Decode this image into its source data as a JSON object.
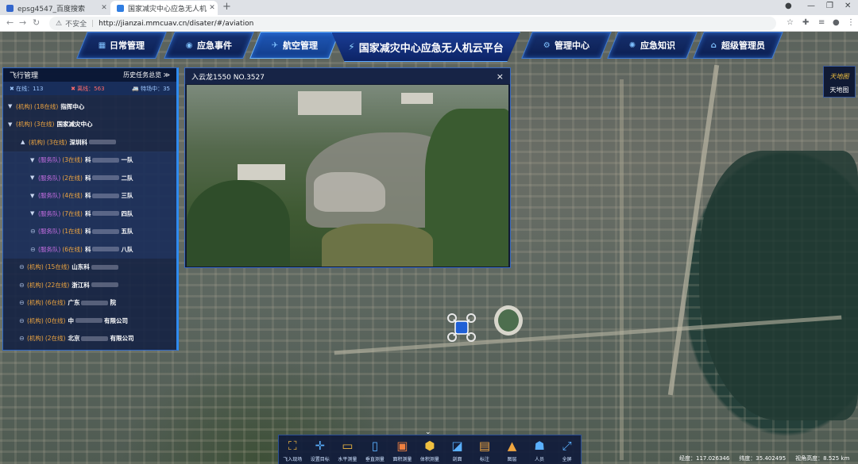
{
  "browser": {
    "tabs": [
      {
        "title": "epsg4547_百度搜索",
        "active": false
      },
      {
        "title": "国家减灾中心应急无人机云平",
        "active": true
      }
    ],
    "url_insecure": "不安全",
    "url": "http://jianzai.mmcuav.cn/disater/#/aviation"
  },
  "nav": {
    "items": [
      {
        "label": "日常管理",
        "icon": "calendar-icon"
      },
      {
        "label": "应急事件",
        "icon": "alert-icon"
      },
      {
        "label": "航空管理",
        "icon": "aviation-icon",
        "active": true
      },
      {
        "label": "管理中心",
        "icon": "gear-icon"
      },
      {
        "label": "应急知识",
        "icon": "knowledge-icon"
      },
      {
        "label": "超级管理员",
        "icon": "home-icon"
      }
    ],
    "title": "国家减灾中心应急无人机云平台"
  },
  "flight_panel": {
    "title": "飞行管理",
    "history": "历史任务总览 ≫",
    "online": "在线：113",
    "offline": "离线：563",
    "frequent": "特场中：35",
    "rows": [
      {
        "level": 0,
        "expand": "down",
        "type": "(机构)",
        "count": "(18在线)",
        "name": "指挥中心"
      },
      {
        "level": 0,
        "expand": "down",
        "type": "(机构)",
        "count": "(3在线)",
        "name": "国家减灾中心"
      },
      {
        "level": 1,
        "expand": "up",
        "type": "(机构)",
        "count": "(3在线)",
        "name": "深圳科"
      },
      {
        "level": 2,
        "expand": "down",
        "type": "(服务队)",
        "count": "(3在线)",
        "name": "科",
        "tail": "一队"
      },
      {
        "level": 2,
        "expand": "down",
        "type": "(服务队)",
        "count": "(2在线)",
        "name": "科",
        "tail": "二队"
      },
      {
        "level": 2,
        "expand": "down",
        "type": "(服务队)",
        "count": "(4在线)",
        "name": "科",
        "tail": "三队"
      },
      {
        "level": 2,
        "expand": "down",
        "type": "(服务队)",
        "count": "(7在线)",
        "name": "科",
        "tail": "四队"
      },
      {
        "level": 2,
        "expand": "circle",
        "type": "(服务队)",
        "count": "(1在线)",
        "name": "科",
        "tail": "五队"
      },
      {
        "level": 2,
        "expand": "circle",
        "type": "(服务队)",
        "count": "(6在线)",
        "name": "科",
        "tail": "八队"
      },
      {
        "level": 0,
        "expand": "circle",
        "type": "(机构)",
        "count": "(15在线)",
        "name": "山东科"
      },
      {
        "level": 0,
        "expand": "circle",
        "type": "(机构)",
        "count": "(22在线)",
        "name": "浙江科"
      },
      {
        "level": 0,
        "expand": "circle",
        "type": "(机构)",
        "count": "(6在线)",
        "name": "广东",
        "tail": "院"
      },
      {
        "level": 0,
        "expand": "circle",
        "type": "(机构)",
        "count": "(0在线)",
        "name": "中",
        "tail": "有限公司"
      },
      {
        "level": 0,
        "expand": "circle",
        "type": "(机构)",
        "count": "(2在线)",
        "name": "北京",
        "tail": "有限公司"
      }
    ]
  },
  "video": {
    "title": "入云龙1550 NO.3527",
    "close": "×"
  },
  "map_toggle": {
    "logo": "天地图",
    "label": "天地图"
  },
  "toolbar": {
    "items": [
      {
        "label": "飞入现场",
        "icon": "fly-icon"
      },
      {
        "label": "设置目标",
        "icon": "target-icon"
      },
      {
        "label": "水平测量",
        "icon": "ruler-icon"
      },
      {
        "label": "垂直测量",
        "icon": "vertical-ruler-icon"
      },
      {
        "label": "面积测量",
        "icon": "area-icon"
      },
      {
        "label": "体积测量",
        "icon": "volume-icon"
      },
      {
        "label": "剖面",
        "icon": "section-icon"
      },
      {
        "label": "标注",
        "icon": "bookmark-icon"
      },
      {
        "label": "图层",
        "icon": "layer-icon"
      },
      {
        "label": "人员",
        "icon": "person-icon"
      },
      {
        "label": "全屏",
        "icon": "fullscreen-icon"
      }
    ]
  },
  "status": {
    "lon": "经度：117.026346",
    "lat": "纬度：35.402495",
    "alt": "视角高度：8.525 km"
  },
  "colors": {
    "nav_bg": "#0c1f52",
    "nav_border": "#3d7bd8",
    "panel_bg": "#122042",
    "org": "#f0a640",
    "team": "#c66ee2",
    "offline": "#ff6b6b"
  }
}
